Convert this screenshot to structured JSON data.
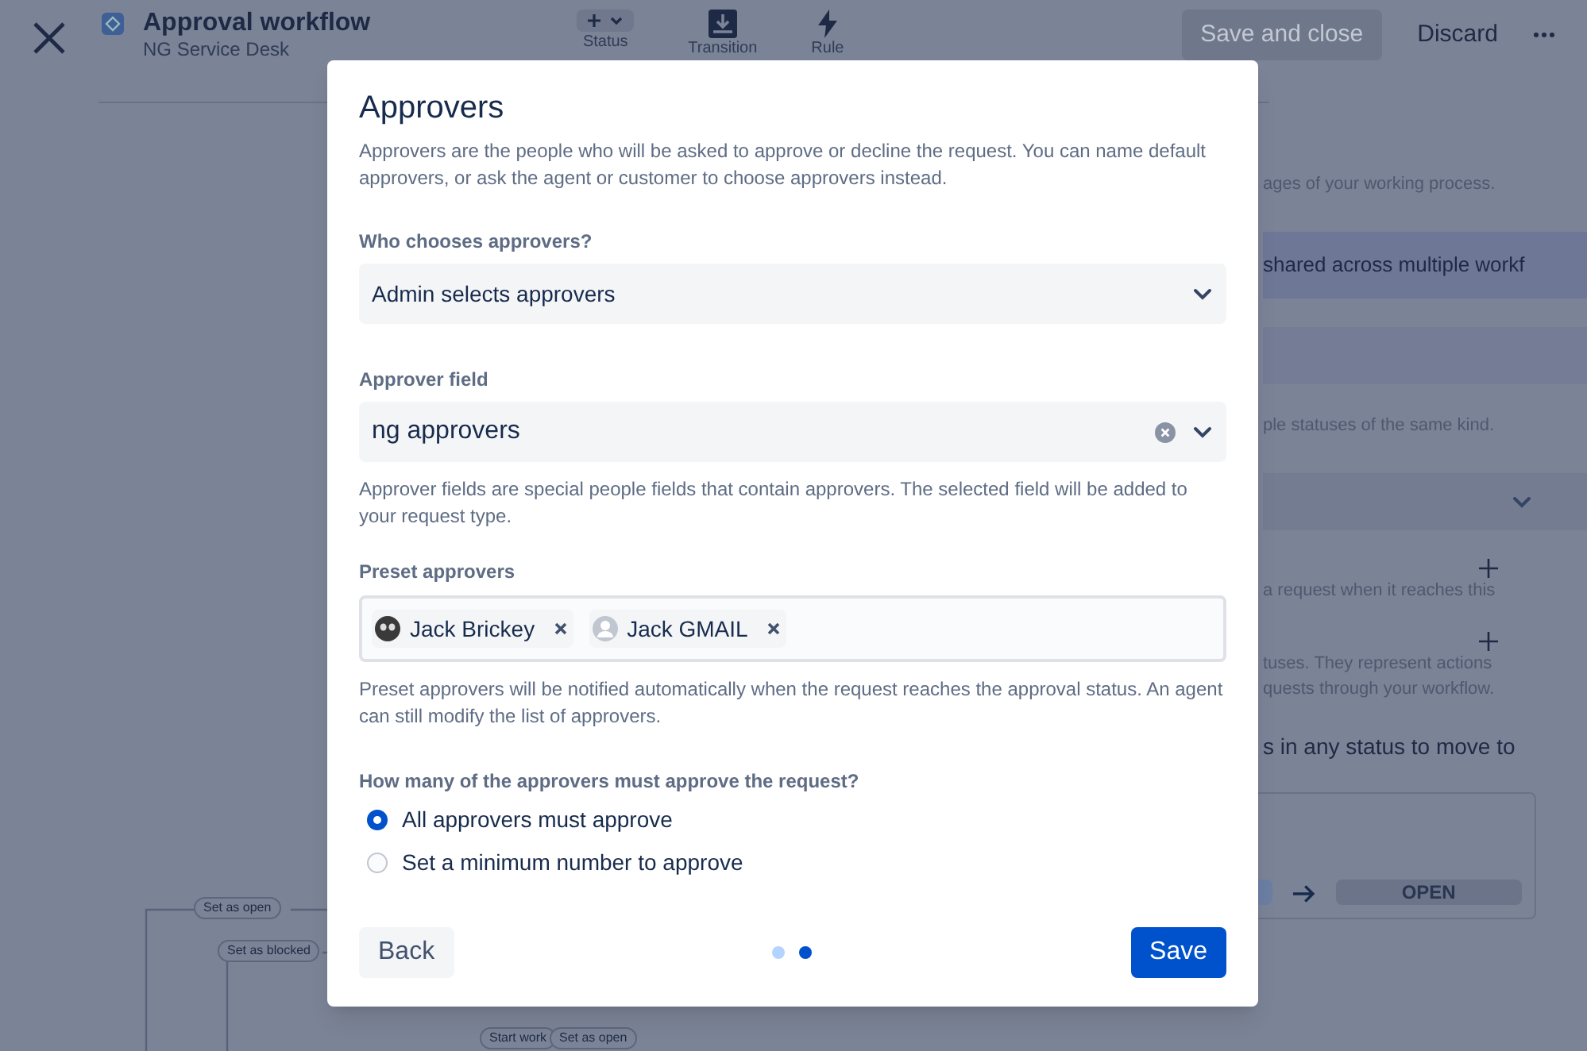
{
  "header": {
    "title": "Approval workflow",
    "subtitle": "NG Service Desk",
    "tools": [
      {
        "label": "Status",
        "kind": "plus"
      },
      {
        "label": "Transition",
        "kind": "transition"
      },
      {
        "label": "Rule",
        "kind": "bolt"
      }
    ],
    "save_button": {
      "label": "Save and close",
      "disabled": true
    },
    "discard_button": {
      "label": "Discard"
    }
  },
  "side_panel": [
    {
      "kind": "text",
      "text": "ages of your working process."
    },
    {
      "kind": "banner",
      "text": "shared across multiple workf"
    },
    {
      "kind": "field"
    },
    {
      "kind": "text",
      "text": "ple statuses of the same kind."
    },
    {
      "kind": "select"
    },
    {
      "kind": "add",
      "text": "a request when it reaches this"
    },
    {
      "kind": "add",
      "text": "tuses. They represent actions\nquests through your workflow."
    },
    {
      "kind": "heading",
      "text": "s in any status to move to"
    },
    {
      "kind": "card",
      "text": "OPEN"
    }
  ],
  "diagram": [
    {
      "label": "Set as open"
    },
    {
      "label": "Set as blocked"
    },
    {
      "label": "Start work"
    },
    {
      "label": "Set as open"
    }
  ],
  "modal": {
    "title": "Approvers",
    "description": "Approvers are the people who will be asked to approve or decline the request. You can name default approvers, or ask the agent or customer to choose approvers instead.",
    "who_chooses": {
      "label": "Who chooses approvers?",
      "value": "Admin selects approvers"
    },
    "approver_field": {
      "label": "Approver field",
      "value": "ng approvers",
      "help": "Approver fields are special people fields that contain approvers. The selected field will be added to your request type."
    },
    "preset": {
      "label": "Preset approvers",
      "people": [
        {
          "name": "Jack Brickey",
          "kind": "custom"
        },
        {
          "name": "Jack GMAIL",
          "kind": "default"
        }
      ],
      "help": "Preset approvers will be notified automatically when the request reaches the approval status. An agent can still modify the list of approvers."
    },
    "how_many": {
      "label": "How many of the approvers must approve the request?",
      "options": [
        {
          "label": "All approvers must approve",
          "selected": true
        },
        {
          "label": "Set a minimum number to approve",
          "selected": false
        }
      ]
    },
    "back_button": "Back",
    "steps": [
      {
        "selected": false
      },
      {
        "selected": true
      }
    ],
    "save_button": "Save"
  }
}
